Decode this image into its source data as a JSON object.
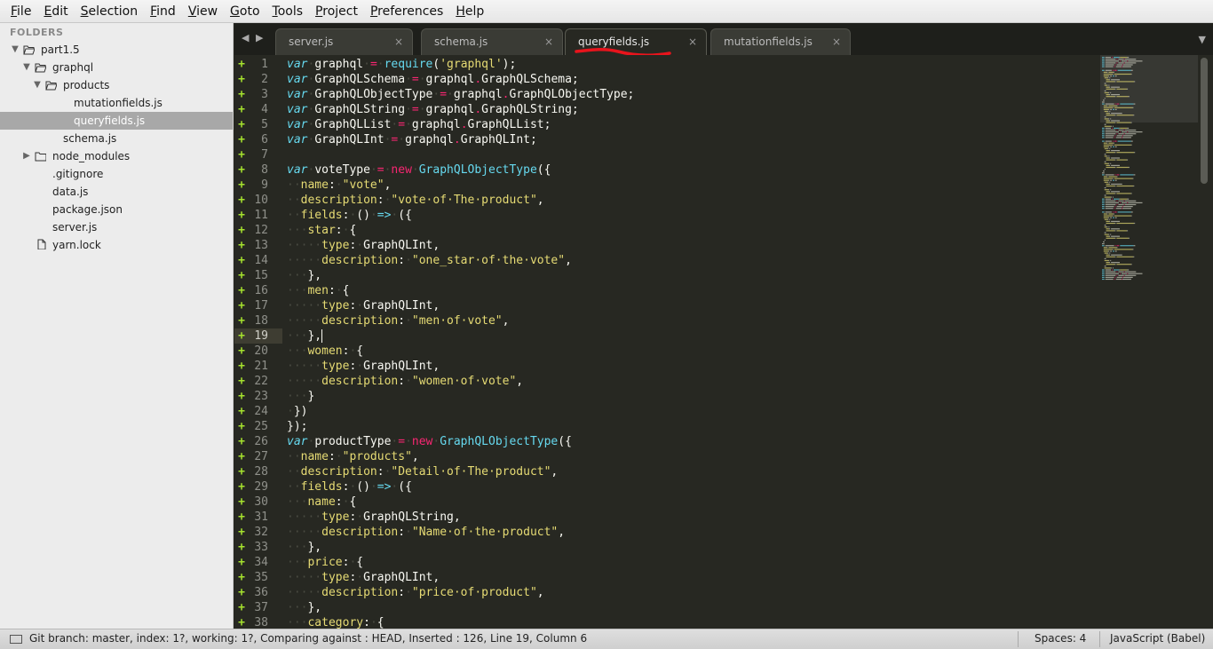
{
  "menu": [
    "File",
    "Edit",
    "Selection",
    "Find",
    "View",
    "Goto",
    "Tools",
    "Project",
    "Preferences",
    "Help"
  ],
  "sidebar": {
    "heading": "FOLDERS",
    "items": [
      {
        "label": "part1.5",
        "kind": "folder",
        "expanded": true,
        "depth": 0
      },
      {
        "label": "graphql",
        "kind": "folder",
        "expanded": true,
        "depth": 1
      },
      {
        "label": "products",
        "kind": "folder",
        "expanded": true,
        "depth": 2
      },
      {
        "label": "mutationfields.js",
        "kind": "file",
        "depth": 4
      },
      {
        "label": "queryfields.js",
        "kind": "file",
        "depth": 4,
        "selected": true
      },
      {
        "label": "schema.js",
        "kind": "file",
        "depth": 3
      },
      {
        "label": "node_modules",
        "kind": "folder",
        "expanded": false,
        "depth": 1
      },
      {
        "label": ".gitignore",
        "kind": "file",
        "depth": 2
      },
      {
        "label": "data.js",
        "kind": "file",
        "depth": 2
      },
      {
        "label": "package.json",
        "kind": "file",
        "depth": 2
      },
      {
        "label": "server.js",
        "kind": "file",
        "depth": 2
      },
      {
        "label": "yarn.lock",
        "kind": "file-icon",
        "depth": 1
      }
    ]
  },
  "tabs": [
    {
      "label": "server.js",
      "close": "×",
      "active": false
    },
    {
      "label": "schema.js",
      "close": "×",
      "active": false
    },
    {
      "label": "queryfields.js",
      "close": "×",
      "active": true
    },
    {
      "label": "mutationfields.js",
      "close": "×",
      "active": false
    }
  ],
  "tab_nav": {
    "left": "◀",
    "right": "▶",
    "overflow": "▼"
  },
  "annotation_color": "#e8141c",
  "editor": {
    "current_line": 19,
    "lines": [
      [
        [
          "kw",
          "var"
        ],
        [
          "ws",
          "·"
        ],
        [
          "t",
          "graphql"
        ],
        [
          "ws",
          "·"
        ],
        [
          "op",
          "="
        ],
        [
          "ws",
          "·"
        ],
        [
          "fn",
          "require"
        ],
        [
          "t",
          "("
        ],
        [
          "str",
          "'graphql'"
        ],
        [
          "t",
          ");"
        ]
      ],
      [
        [
          "kw",
          "var"
        ],
        [
          "ws",
          "·"
        ],
        [
          "t",
          "GraphQLSchema"
        ],
        [
          "ws",
          "·"
        ],
        [
          "op",
          "="
        ],
        [
          "ws",
          "·"
        ],
        [
          "t",
          "graphql"
        ],
        [
          "op",
          "."
        ],
        [
          "t",
          "GraphQLSchema;"
        ]
      ],
      [
        [
          "kw",
          "var"
        ],
        [
          "ws",
          "·"
        ],
        [
          "t",
          "GraphQLObjectType"
        ],
        [
          "ws",
          "·"
        ],
        [
          "op",
          "="
        ],
        [
          "ws",
          "·"
        ],
        [
          "t",
          "graphql"
        ],
        [
          "op",
          "."
        ],
        [
          "t",
          "GraphQLObjectType;"
        ]
      ],
      [
        [
          "kw",
          "var"
        ],
        [
          "ws",
          "·"
        ],
        [
          "t",
          "GraphQLString"
        ],
        [
          "ws",
          "·"
        ],
        [
          "op",
          "="
        ],
        [
          "ws",
          "·"
        ],
        [
          "t",
          "graphql"
        ],
        [
          "op",
          "."
        ],
        [
          "t",
          "GraphQLString;"
        ]
      ],
      [
        [
          "kw",
          "var"
        ],
        [
          "ws",
          "·"
        ],
        [
          "t",
          "GraphQLList"
        ],
        [
          "ws",
          "·"
        ],
        [
          "op",
          "="
        ],
        [
          "ws",
          "·"
        ],
        [
          "t",
          "graphql"
        ],
        [
          "op",
          "."
        ],
        [
          "t",
          "GraphQLList;"
        ]
      ],
      [
        [
          "kw",
          "var"
        ],
        [
          "ws",
          "·"
        ],
        [
          "t",
          "GraphQLInt"
        ],
        [
          "ws",
          "·"
        ],
        [
          "op",
          "="
        ],
        [
          "ws",
          "·"
        ],
        [
          "t",
          "graphql"
        ],
        [
          "op",
          "."
        ],
        [
          "t",
          "GraphQLInt;"
        ]
      ],
      [],
      [
        [
          "kw",
          "var"
        ],
        [
          "ws",
          "·"
        ],
        [
          "t",
          "voteType"
        ],
        [
          "ws",
          "·"
        ],
        [
          "op",
          "="
        ],
        [
          "ws",
          "·"
        ],
        [
          "new",
          "new"
        ],
        [
          "ws",
          "·"
        ],
        [
          "fn",
          "GraphQLObjectType"
        ],
        [
          "t",
          "({"
        ]
      ],
      [
        [
          "ws",
          "··"
        ],
        [
          "prop",
          "name"
        ],
        [
          "t",
          ":"
        ],
        [
          "ws",
          "·"
        ],
        [
          "str",
          "\"vote\""
        ],
        [
          "t",
          ","
        ]
      ],
      [
        [
          "ws",
          "··"
        ],
        [
          "prop",
          "description"
        ],
        [
          "t",
          ":"
        ],
        [
          "ws",
          "·"
        ],
        [
          "str",
          "\"vote·of·The·product\""
        ],
        [
          "t",
          ","
        ]
      ],
      [
        [
          "ws",
          "··"
        ],
        [
          "prop",
          "fields"
        ],
        [
          "t",
          ":"
        ],
        [
          "ws",
          "·"
        ],
        [
          "t",
          "()"
        ],
        [
          "ws",
          "·"
        ],
        [
          "fn",
          "=>"
        ],
        [
          "ws",
          "·"
        ],
        [
          "t",
          "({"
        ]
      ],
      [
        [
          "ws",
          "···"
        ],
        [
          "prop",
          "star"
        ],
        [
          "t",
          ":"
        ],
        [
          "ws",
          "·"
        ],
        [
          "t",
          "{"
        ]
      ],
      [
        [
          "ws",
          "·····"
        ],
        [
          "prop",
          "type"
        ],
        [
          "t",
          ":"
        ],
        [
          "ws",
          "·"
        ],
        [
          "t",
          "GraphQLInt,"
        ]
      ],
      [
        [
          "ws",
          "·····"
        ],
        [
          "prop",
          "description"
        ],
        [
          "t",
          ":"
        ],
        [
          "ws",
          "·"
        ],
        [
          "str",
          "\"one_star·of·the·vote\""
        ],
        [
          "t",
          ","
        ]
      ],
      [
        [
          "ws",
          "···"
        ],
        [
          "t",
          "},"
        ]
      ],
      [
        [
          "ws",
          "···"
        ],
        [
          "prop",
          "men"
        ],
        [
          "t",
          ":"
        ],
        [
          "ws",
          "·"
        ],
        [
          "t",
          "{"
        ]
      ],
      [
        [
          "ws",
          "·····"
        ],
        [
          "prop",
          "type"
        ],
        [
          "t",
          ":"
        ],
        [
          "ws",
          "·"
        ],
        [
          "t",
          "GraphQLInt,"
        ]
      ],
      [
        [
          "ws",
          "·····"
        ],
        [
          "prop",
          "description"
        ],
        [
          "t",
          ":"
        ],
        [
          "ws",
          "·"
        ],
        [
          "str",
          "\"men·of·vote\""
        ],
        [
          "t",
          ","
        ]
      ],
      [
        [
          "ws",
          "···"
        ],
        [
          "t",
          "},"
        ],
        [
          "caret",
          ""
        ]
      ],
      [
        [
          "ws",
          "···"
        ],
        [
          "prop",
          "women"
        ],
        [
          "t",
          ":"
        ],
        [
          "ws",
          "·"
        ],
        [
          "t",
          "{"
        ]
      ],
      [
        [
          "ws",
          "·····"
        ],
        [
          "prop",
          "type"
        ],
        [
          "t",
          ":"
        ],
        [
          "ws",
          "·"
        ],
        [
          "t",
          "GraphQLInt,"
        ]
      ],
      [
        [
          "ws",
          "·····"
        ],
        [
          "prop",
          "description"
        ],
        [
          "t",
          ":"
        ],
        [
          "ws",
          "·"
        ],
        [
          "str",
          "\"women·of·vote\""
        ],
        [
          "t",
          ","
        ]
      ],
      [
        [
          "ws",
          "···"
        ],
        [
          "t",
          "}"
        ]
      ],
      [
        [
          "ws",
          "·"
        ],
        [
          "t",
          "})"
        ]
      ],
      [
        [
          "t",
          "});"
        ]
      ],
      [
        [
          "kw",
          "var"
        ],
        [
          "ws",
          "·"
        ],
        [
          "t",
          "productType"
        ],
        [
          "ws",
          "·"
        ],
        [
          "op",
          "="
        ],
        [
          "ws",
          "·"
        ],
        [
          "new",
          "new"
        ],
        [
          "ws",
          "·"
        ],
        [
          "fn",
          "GraphQLObjectType"
        ],
        [
          "t",
          "({"
        ]
      ],
      [
        [
          "ws",
          "··"
        ],
        [
          "prop",
          "name"
        ],
        [
          "t",
          ":"
        ],
        [
          "ws",
          "·"
        ],
        [
          "str",
          "\"products\""
        ],
        [
          "t",
          ","
        ]
      ],
      [
        [
          "ws",
          "··"
        ],
        [
          "prop",
          "description"
        ],
        [
          "t",
          ":"
        ],
        [
          "ws",
          "·"
        ],
        [
          "str",
          "\"Detail·of·The·product\""
        ],
        [
          "t",
          ","
        ]
      ],
      [
        [
          "ws",
          "··"
        ],
        [
          "prop",
          "fields"
        ],
        [
          "t",
          ":"
        ],
        [
          "ws",
          "·"
        ],
        [
          "t",
          "()"
        ],
        [
          "ws",
          "·"
        ],
        [
          "fn",
          "=>"
        ],
        [
          "ws",
          "·"
        ],
        [
          "t",
          "({"
        ]
      ],
      [
        [
          "ws",
          "···"
        ],
        [
          "prop",
          "name"
        ],
        [
          "t",
          ":"
        ],
        [
          "ws",
          "·"
        ],
        [
          "t",
          "{"
        ]
      ],
      [
        [
          "ws",
          "·····"
        ],
        [
          "prop",
          "type"
        ],
        [
          "t",
          ":"
        ],
        [
          "ws",
          "·"
        ],
        [
          "t",
          "GraphQLString,"
        ]
      ],
      [
        [
          "ws",
          "·····"
        ],
        [
          "prop",
          "description"
        ],
        [
          "t",
          ":"
        ],
        [
          "ws",
          "·"
        ],
        [
          "str",
          "\"Name·of·the·product\""
        ],
        [
          "t",
          ","
        ]
      ],
      [
        [
          "ws",
          "···"
        ],
        [
          "t",
          "},"
        ]
      ],
      [
        [
          "ws",
          "···"
        ],
        [
          "prop",
          "price"
        ],
        [
          "t",
          ":"
        ],
        [
          "ws",
          "·"
        ],
        [
          "t",
          "{"
        ]
      ],
      [
        [
          "ws",
          "·····"
        ],
        [
          "prop",
          "type"
        ],
        [
          "t",
          ":"
        ],
        [
          "ws",
          "·"
        ],
        [
          "t",
          "GraphQLInt,"
        ]
      ],
      [
        [
          "ws",
          "·····"
        ],
        [
          "prop",
          "description"
        ],
        [
          "t",
          ":"
        ],
        [
          "ws",
          "·"
        ],
        [
          "str",
          "\"price·of·product\""
        ],
        [
          "t",
          ","
        ]
      ],
      [
        [
          "ws",
          "···"
        ],
        [
          "t",
          "},"
        ]
      ],
      [
        [
          "ws",
          "···"
        ],
        [
          "prop",
          "category"
        ],
        [
          "t",
          ":"
        ],
        [
          "ws",
          "·"
        ],
        [
          "t",
          "{"
        ]
      ]
    ]
  },
  "status": {
    "text": "Git branch: master, index: 1?, working: 1?, Comparing against : HEAD, Inserted : 126, Line 19, Column 6",
    "spaces": "Spaces: 4",
    "syntax": "JavaScript (Babel)"
  }
}
